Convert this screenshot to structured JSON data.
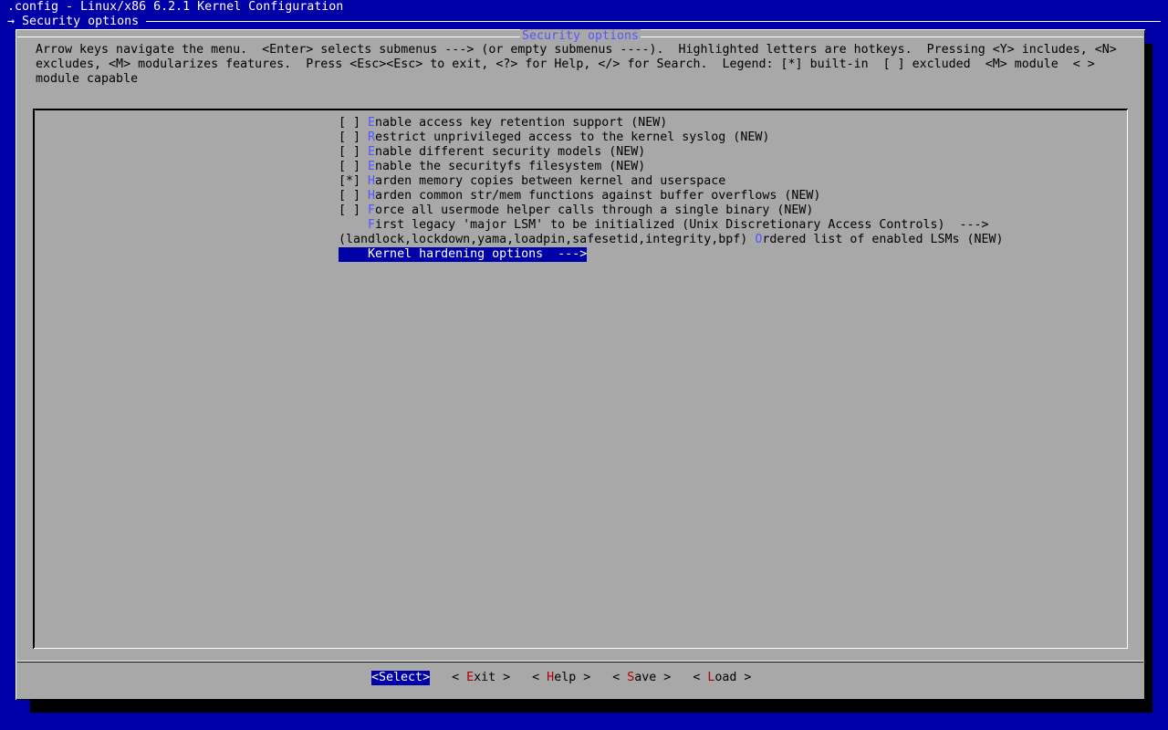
{
  "header": {
    "title": ".config - Linux/x86 6.2.1 Kernel Configuration",
    "breadcrumb_arrow": "→",
    "breadcrumb": "Security options"
  },
  "dialog": {
    "title": "Security options",
    "help_text": "Arrow keys navigate the menu.  <Enter> selects submenus ---> (or empty submenus ----).  Highlighted letters are hotkeys.  Pressing <Y> includes, <N> excludes, <M> modularizes features.  Press <Esc><Esc> to exit, <?> for Help, </> for Search.  Legend: [*] built-in  [ ] excluded  <M> module  < > module capable"
  },
  "menu": {
    "items": [
      {
        "pre": "[ ] ",
        "hotkey": "E",
        "rest": "nable access key retention support (NEW)",
        "post": ""
      },
      {
        "pre": "[ ] ",
        "hotkey": "R",
        "rest": "estrict unprivileged access to the kernel syslog (NEW)",
        "post": ""
      },
      {
        "pre": "[ ] ",
        "hotkey": "E",
        "rest": "nable different security models (NEW)",
        "post": ""
      },
      {
        "pre": "[ ] ",
        "hotkey": "E",
        "rest": "nable the securityfs filesystem (NEW)",
        "post": ""
      },
      {
        "pre": "[*] ",
        "hotkey": "H",
        "rest": "arden memory copies between kernel and userspace",
        "post": ""
      },
      {
        "pre": "[ ] ",
        "hotkey": "H",
        "rest": "arden common str/mem functions against buffer overflows (NEW)",
        "post": ""
      },
      {
        "pre": "[ ] ",
        "hotkey": "F",
        "rest": "orce all usermode helper calls through a single binary (NEW)",
        "post": ""
      },
      {
        "pre": "    ",
        "hotkey": "F",
        "rest": "irst legacy 'major LSM' to be initialized (Unix Discretionary Access Controls)  --->",
        "post": ""
      },
      {
        "pre": "(landlock,lockdown,yama,loadpin,safesetid,integrity,bpf) ",
        "hotkey": "O",
        "rest": "rdered list of enabled LSMs (NEW)",
        "post": ""
      },
      {
        "pre": "    ",
        "hotkey": "K",
        "rest": "ernel hardening options  --->",
        "post": ""
      }
    ],
    "selected_index": 9
  },
  "buttons": [
    {
      "open": "<",
      "hotkey": "S",
      "rest": "elect",
      "close": ">"
    },
    {
      "open": "< ",
      "hotkey": "E",
      "rest": "xit",
      "close": " >"
    },
    {
      "open": "< ",
      "hotkey": "H",
      "rest": "elp",
      "close": " >"
    },
    {
      "open": "< ",
      "hotkey": "S",
      "rest": "ave",
      "close": " >"
    },
    {
      "open": "< ",
      "hotkey": "L",
      "rest": "oad",
      "close": " >"
    }
  ],
  "colors": {
    "background": "#0000a8",
    "dialog": "#a8a8a8",
    "hotkey": "#5555ff",
    "button_hotkey": "#a80000",
    "selection": "#0000a8"
  }
}
